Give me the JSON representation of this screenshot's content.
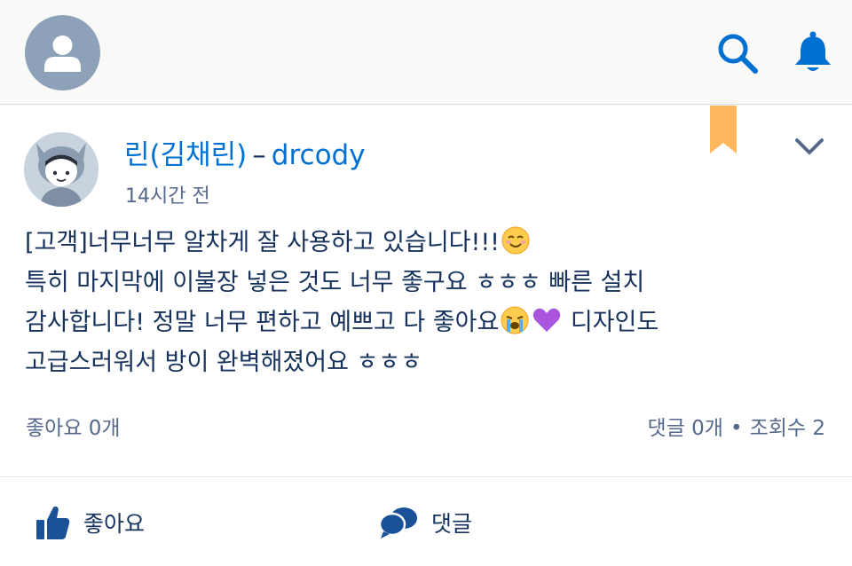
{
  "header": {
    "avatar_icon": "user-avatar-icon",
    "search_icon": "search-icon",
    "notifications_icon": "bell-icon"
  },
  "post": {
    "author_name": "린(김채린)",
    "separator": "–",
    "group_name": "drcody",
    "timestamp": "14시간 전",
    "body_lines": [
      "[고객]너무너무 알차게 잘 사용하고 있습니다!!!",
      "특히 마지막에 이불장 넣은 것도 너무 좋구요 ㅎㅎㅎ 빠른 설치",
      "감사합니다! 정말 너무 편하고 예쁘고 다 좋아요",
      "디자인도",
      "고급스러워서 방이 완벽해졌어요 ㅎㅎㅎ"
    ],
    "stats": {
      "likes": "좋아요 0개",
      "comments": "댓글 0개",
      "dot": "•",
      "views": "조회수 2"
    }
  },
  "actions": {
    "like_label": "좋아요",
    "comment_label": "댓글"
  },
  "colors": {
    "accent": "#0070d2",
    "text": "#16325c",
    "muted": "#54698d",
    "bookmark": "#ffb75d",
    "icon": "#1b5297"
  }
}
